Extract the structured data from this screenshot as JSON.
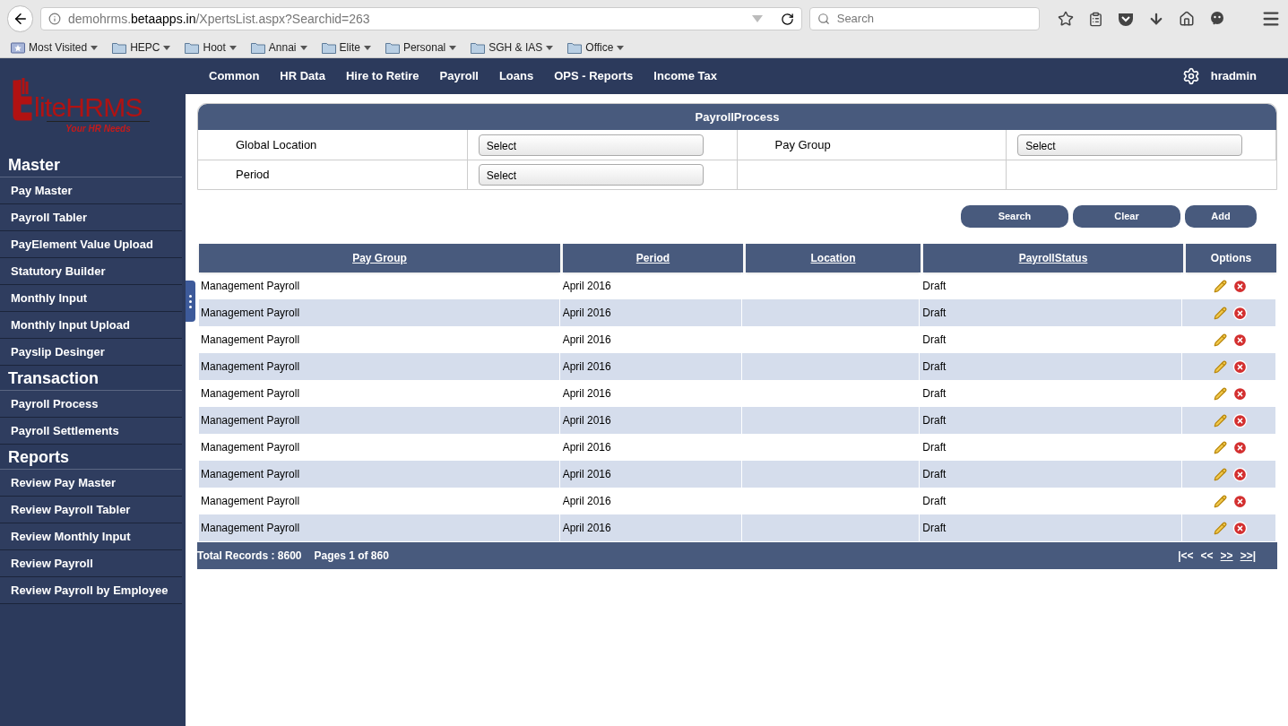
{
  "browser": {
    "url_host": "demohrms.",
    "url_domain": "betaapps.in",
    "url_path": "/XpertsList.aspx?Searchid=263",
    "search_placeholder": "Search",
    "bookmarks": [
      {
        "label": "Most Visited",
        "kind": "special"
      },
      {
        "label": "HEPC",
        "kind": "folder"
      },
      {
        "label": "Hoot",
        "kind": "folder"
      },
      {
        "label": "Annai",
        "kind": "folder"
      },
      {
        "label": "Elite",
        "kind": "folder"
      },
      {
        "label": "Personal",
        "kind": "folder"
      },
      {
        "label": "SGH & IAS",
        "kind": "folder"
      },
      {
        "label": "Office",
        "kind": "folder"
      }
    ]
  },
  "logo": {
    "name_first": "lite",
    "name_second": "HRMS",
    "tagline": "Your HR Needs"
  },
  "nav": [
    "Common",
    "HR Data",
    "Hire to Retire",
    "Payroll",
    "Loans",
    "OPS - Reports",
    "Income Tax"
  ],
  "user": "hradmin",
  "sidebar": [
    {
      "heading": "Master",
      "items": [
        "Pay Master",
        "Payroll Tabler",
        "PayElement Value Upload",
        "Statutory Builder",
        "Monthly Input",
        "Monthly Input Upload",
        "Payslip Desinger"
      ]
    },
    {
      "heading": "Transaction",
      "items": [
        "Payroll Process",
        "Payroll Settlements"
      ]
    },
    {
      "heading": "Reports",
      "items": [
        "Review Pay Master",
        "Review Payroll Tabler",
        "Review Monthly Input",
        "Review Payroll",
        "Review Payroll by Employee"
      ]
    }
  ],
  "form": {
    "title": "PayrollProcess",
    "fields": [
      {
        "label": "Global Location",
        "value": "Select"
      },
      {
        "label": "Pay Group",
        "value": "Select"
      },
      {
        "label": "Period",
        "value": "Select"
      }
    ]
  },
  "buttons": [
    "Search",
    "Clear",
    "Add"
  ],
  "table": {
    "columns": [
      {
        "label": "Pay Group",
        "sortable": true
      },
      {
        "label": "Period",
        "sortable": true
      },
      {
        "label": "Location",
        "sortable": true
      },
      {
        "label": "PayrollStatus",
        "sortable": true
      },
      {
        "label": "Options",
        "sortable": false
      }
    ],
    "rows": [
      {
        "pay_group": "Management Payroll",
        "period": "April 2016",
        "location": "",
        "status": "Draft"
      },
      {
        "pay_group": "Management Payroll",
        "period": "April 2016",
        "location": "",
        "status": "Draft"
      },
      {
        "pay_group": "Management Payroll",
        "period": "April 2016",
        "location": "",
        "status": "Draft"
      },
      {
        "pay_group": "Management Payroll",
        "period": "April 2016",
        "location": "",
        "status": "Draft"
      },
      {
        "pay_group": "Management Payroll",
        "period": "April 2016",
        "location": "",
        "status": "Draft"
      },
      {
        "pay_group": "Management Payroll",
        "period": "April 2016",
        "location": "",
        "status": "Draft"
      },
      {
        "pay_group": "Management Payroll",
        "period": "April 2016",
        "location": "",
        "status": "Draft"
      },
      {
        "pay_group": "Management Payroll",
        "period": "April 2016",
        "location": "",
        "status": "Draft"
      },
      {
        "pay_group": "Management Payroll",
        "period": "April 2016",
        "location": "",
        "status": "Draft"
      },
      {
        "pay_group": "Management Payroll",
        "period": "April 2016",
        "location": "",
        "status": "Draft"
      }
    ]
  },
  "footer": {
    "total": "Total Records : 8600",
    "pages": "Pages 1 of 860",
    "pager": [
      {
        "label": "|<<",
        "enabled": false
      },
      {
        "label": "<<",
        "enabled": false
      },
      {
        "label": ">>",
        "enabled": true
      },
      {
        "label": ">>|",
        "enabled": true
      }
    ]
  }
}
